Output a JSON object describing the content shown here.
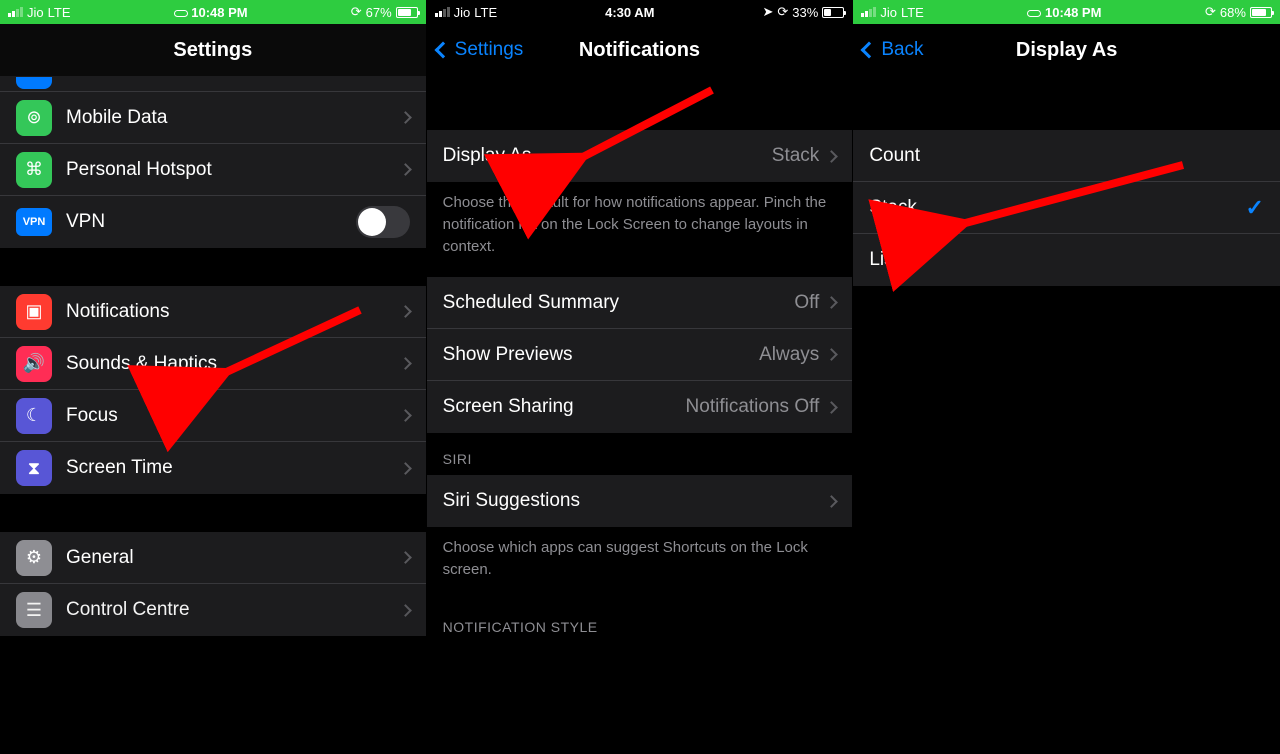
{
  "phone1": {
    "status": {
      "carrier": "Jio",
      "network": "LTE",
      "time": "10:48 PM",
      "battery_pct": "67%",
      "battery_fill": 67
    },
    "nav": {
      "title": "Settings"
    },
    "group1": [
      {
        "label": "Mobile Data",
        "icon": "antenna-icon",
        "color": "ic-green",
        "glyph": "⟡"
      },
      {
        "label": "Personal Hotspot",
        "icon": "link-icon",
        "color": "ic-green",
        "glyph": "⎘"
      },
      {
        "label": "VPN",
        "icon": "vpn-icon",
        "toggle": true
      }
    ],
    "group2": [
      {
        "label": "Notifications",
        "icon": "bell-icon",
        "color": "ic-red",
        "glyph": "◉"
      },
      {
        "label": "Sounds & Haptics",
        "icon": "speaker-icon",
        "color": "ic-pink",
        "glyph": "◀"
      },
      {
        "label": "Focus",
        "icon": "moon-icon",
        "color": "ic-indigo",
        "glyph": "☾"
      },
      {
        "label": "Screen Time",
        "icon": "hourglass-icon",
        "color": "ic-indigo",
        "glyph": "⧗"
      }
    ],
    "group3": [
      {
        "label": "General",
        "icon": "gear-icon",
        "color": "ic-gray",
        "glyph": "⚙"
      },
      {
        "label": "Control Centre",
        "icon": "switches-icon",
        "color": "ic-gray",
        "glyph": "≣"
      }
    ]
  },
  "phone2": {
    "status": {
      "carrier": "Jio",
      "network": "LTE",
      "time": "4:30 AM",
      "battery_pct": "33%",
      "battery_fill": 33
    },
    "nav": {
      "back": "Settings",
      "title": "Notifications"
    },
    "rows1": [
      {
        "label": "Display As",
        "value": "Stack"
      }
    ],
    "footer1": "Choose the default for how notifications appear. Pinch the notification list on the Lock Screen to change layouts in context.",
    "rows2": [
      {
        "label": "Scheduled Summary",
        "value": "Off"
      },
      {
        "label": "Show Previews",
        "value": "Always"
      },
      {
        "label": "Screen Sharing",
        "value": "Notifications Off"
      }
    ],
    "siri_header": "SIRI",
    "rows3": [
      {
        "label": "Siri Suggestions",
        "value": ""
      }
    ],
    "footer2": "Choose which apps can suggest Shortcuts on the Lock screen.",
    "notif_style_header": "NOTIFICATION STYLE"
  },
  "phone3": {
    "status": {
      "carrier": "Jio",
      "network": "LTE",
      "time": "10:48 PM",
      "battery_pct": "68%",
      "battery_fill": 68
    },
    "nav": {
      "back": "Back",
      "title": "Display As"
    },
    "options": [
      {
        "label": "Count",
        "selected": false
      },
      {
        "label": "Stack",
        "selected": true
      },
      {
        "label": "List",
        "selected": false
      }
    ]
  }
}
